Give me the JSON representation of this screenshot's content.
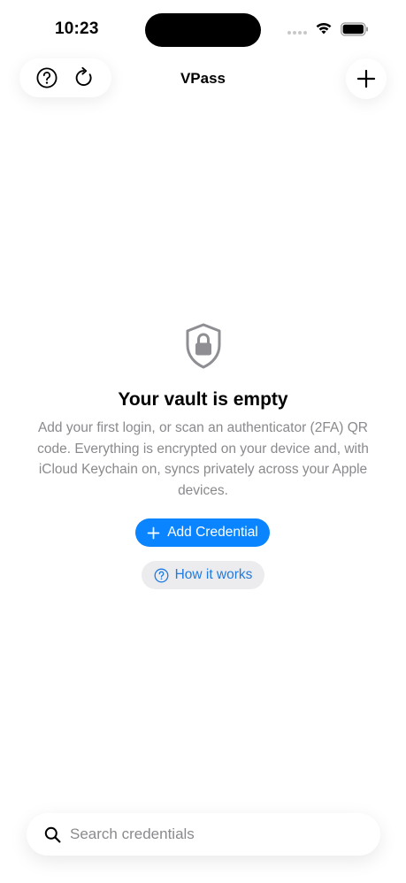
{
  "status_bar": {
    "time": "10:23"
  },
  "nav": {
    "title": "VPass",
    "help_icon": "question-circle-icon",
    "refresh_icon": "refresh-icon",
    "add_icon": "plus-icon"
  },
  "empty_state": {
    "icon": "shield-lock-icon",
    "title": "Your vault is empty",
    "description": "Add your first login, or scan an authenticator (2FA) QR code. Everything is encrypted on your device and, with iCloud Keychain on, syncs privately across your Apple devices.",
    "primary_button": "Add Credential",
    "secondary_button": "How it works"
  },
  "search": {
    "placeholder": "Search credentials"
  },
  "colors": {
    "accent": "#0a84ff",
    "secondary_text": "#8a8a8e",
    "secondary_button_bg": "#ececef"
  }
}
